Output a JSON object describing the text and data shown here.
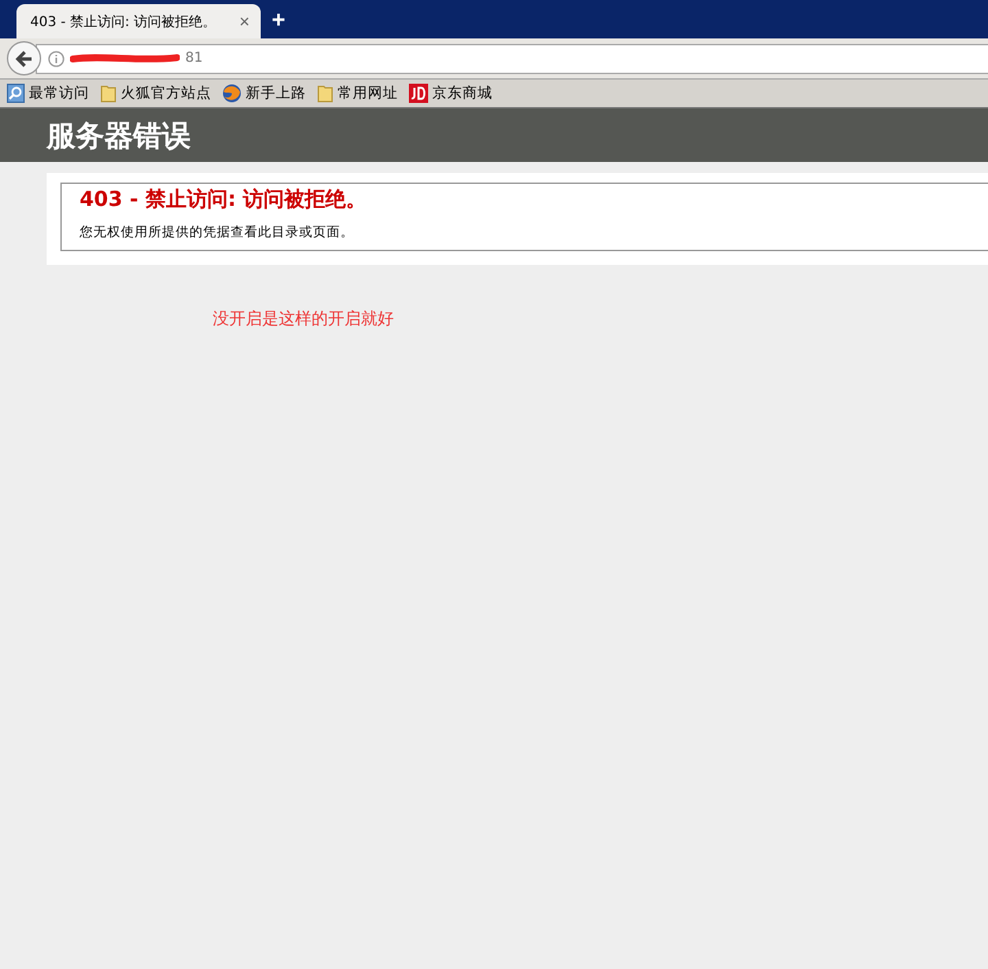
{
  "browser": {
    "tab": {
      "title": "403 - 禁止访问: 访问被拒绝。",
      "close": "×",
      "selected": true
    },
    "new_tab": "+",
    "address": {
      "value": "81"
    },
    "bookmarks": [
      {
        "kind": "app",
        "label": "最常访问"
      },
      {
        "kind": "folder",
        "label": "火狐官方站点"
      },
      {
        "kind": "firefox",
        "label": "新手上路"
      },
      {
        "kind": "folder",
        "label": "常用网址"
      },
      {
        "kind": "jd",
        "label": "京东商城"
      }
    ]
  },
  "page": {
    "header": "服务器错误",
    "error_title": "403 - 禁止访问: 访问被拒绝。",
    "error_message": "您无权使用所提供的凭据查看此目录或页面。"
  },
  "annotation": "没开启是这样的开启就好"
}
